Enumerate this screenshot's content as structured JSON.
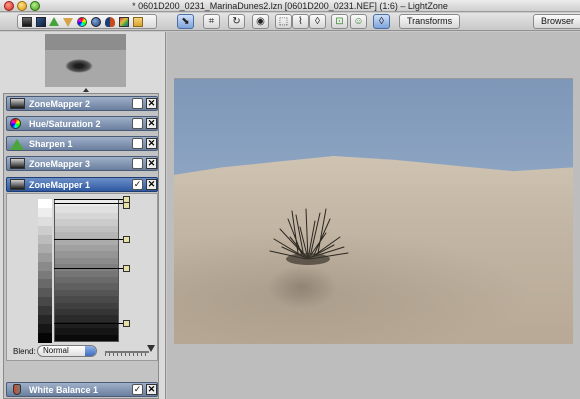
{
  "window": {
    "title": "* 0601D200_0231_MarinaDunes2.lzn [0601D200_0231.NEF] (1:6) – LightZone"
  },
  "toolbar": {
    "transforms_label": "Transforms",
    "browser_label": "Browser",
    "left_tool_icons": [
      "zonemapper-icon",
      "relight-icon",
      "sharpen-icon",
      "noise-icon",
      "hue-saturation-icon",
      "color-balance-icon",
      "white-balance-icon",
      "channel-mixer-icon",
      "clone-icon"
    ],
    "right_tool_icons": [
      "arrow-icon",
      "crop-icon",
      "rotate-icon",
      "eye-icon",
      "region-rect-icon",
      "region-spline-icon",
      "drop-icon",
      "lock-icon",
      "person-icon",
      "drop-selected-icon"
    ]
  },
  "tools": [
    {
      "name": "ZoneMapper 2",
      "icon": "zonemapper-icon",
      "enabled": false
    },
    {
      "name": "Hue/Saturation 2",
      "icon": "hue-saturation-icon",
      "enabled": false
    },
    {
      "name": "Sharpen 1",
      "icon": "sharpen-icon",
      "enabled": false
    },
    {
      "name": "ZoneMapper 3",
      "icon": "zonemapper-icon",
      "enabled": false
    },
    {
      "name": "ZoneMapper 1",
      "icon": "zonemapper-icon",
      "enabled": true
    },
    {
      "name": "White Balance 1",
      "icon": "white-balance-icon",
      "enabled": true
    }
  ],
  "zonemapper": {
    "blend_label": "Blend:",
    "blend_value": "Normal",
    "opacity_fraction": 1.0
  },
  "colors": {
    "selected_tool": "#2f5aa0",
    "tool_header": "#6a7f9f",
    "sky": "#8da4c0",
    "sand": "#c3b6a4"
  }
}
